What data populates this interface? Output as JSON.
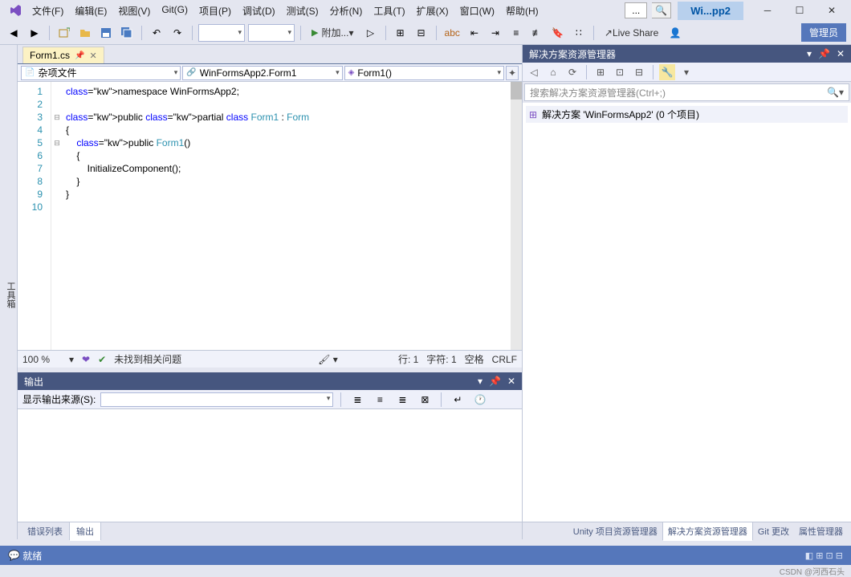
{
  "menu": {
    "file": "文件(F)",
    "edit": "编辑(E)",
    "view": "视图(V)",
    "git": "Git(G)",
    "project": "项目(P)",
    "debug": "调试(D)",
    "test": "测试(S)",
    "analyze": "分析(N)",
    "tools": "工具(T)",
    "extensions": "扩展(X)",
    "window": "窗口(W)",
    "help": "帮助(H)"
  },
  "title": {
    "solution": "Wi...pp2",
    "admin": "管理员"
  },
  "toolbar": {
    "attach": "附加...",
    "liveshare": "Live Share"
  },
  "doc": {
    "tab": "Form1.cs"
  },
  "nav": {
    "scope": "杂项文件",
    "class": "WinFormsApp2.Form1",
    "member": "Form1()"
  },
  "code": {
    "lines": [
      {
        "n": "1",
        "t": "namespace WinFormsApp2;"
      },
      {
        "n": "2",
        "t": ""
      },
      {
        "n": "3",
        "t": "public partial class Form1 : Form"
      },
      {
        "n": "4",
        "t": "{"
      },
      {
        "n": "5",
        "t": "    public Form1()"
      },
      {
        "n": "6",
        "t": "    {"
      },
      {
        "n": "7",
        "t": "        InitializeComponent();"
      },
      {
        "n": "8",
        "t": "    }"
      },
      {
        "n": "9",
        "t": "}"
      },
      {
        "n": "10",
        "t": ""
      }
    ]
  },
  "editorStatus": {
    "zoom": "100 %",
    "issues": "未找到相关问题",
    "line": "行: 1",
    "col": "字符: 1",
    "spaces": "空格",
    "eol": "CRLF"
  },
  "output": {
    "title": "输出",
    "sourceLabel": "显示输出来源(S):"
  },
  "bottomTabs": {
    "errors": "错误列表",
    "output": "输出"
  },
  "sln": {
    "title": "解决方案资源管理器",
    "searchPlaceholder": "搜索解决方案资源管理器(Ctrl+;)",
    "root": "解决方案 'WinFormsApp2' (0 个项目)"
  },
  "rightTabs": {
    "unity": "Unity 项目资源管理器",
    "sln": "解决方案资源管理器",
    "git": "Git 更改",
    "props": "属性管理器"
  },
  "status": {
    "ready": "就绪",
    "watermark": "CSDN @河西石头"
  },
  "leftRail": "工具箱",
  "topSearch": "..."
}
